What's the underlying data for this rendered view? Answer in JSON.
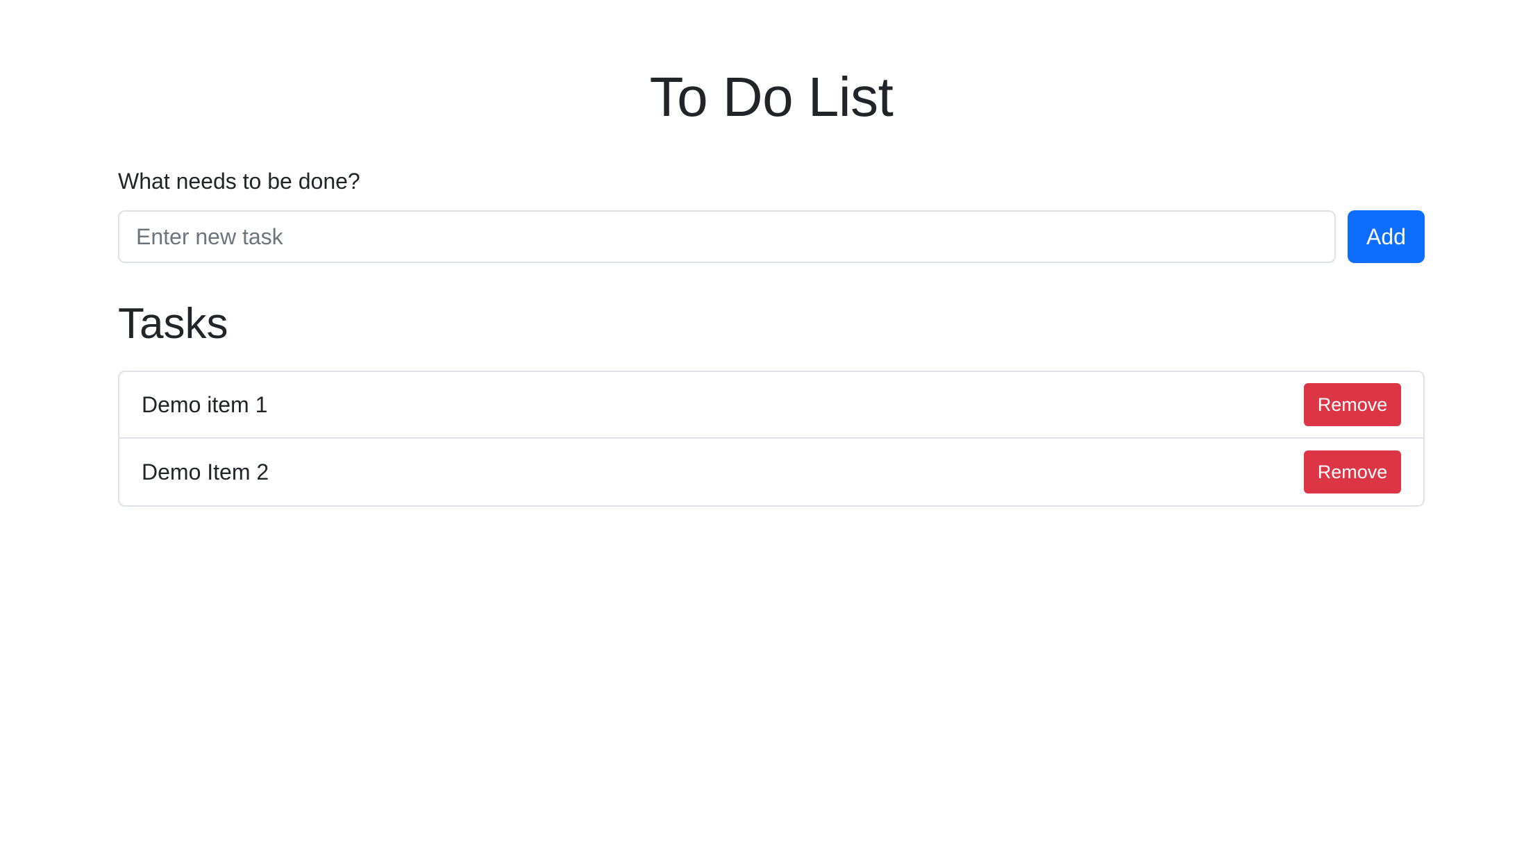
{
  "header": {
    "title": "To Do List"
  },
  "form": {
    "label": "What needs to be done?",
    "input_placeholder": "Enter new task",
    "input_value": "",
    "add_label": "Add"
  },
  "tasks_section": {
    "title": "Tasks",
    "items": [
      {
        "text": "Demo item 1",
        "remove_label": "Remove"
      },
      {
        "text": "Demo Item 2",
        "remove_label": "Remove"
      }
    ]
  },
  "colors": {
    "primary": "#0d6efd",
    "danger": "#dc3545",
    "border": "#dee2e6",
    "text": "#212529"
  }
}
